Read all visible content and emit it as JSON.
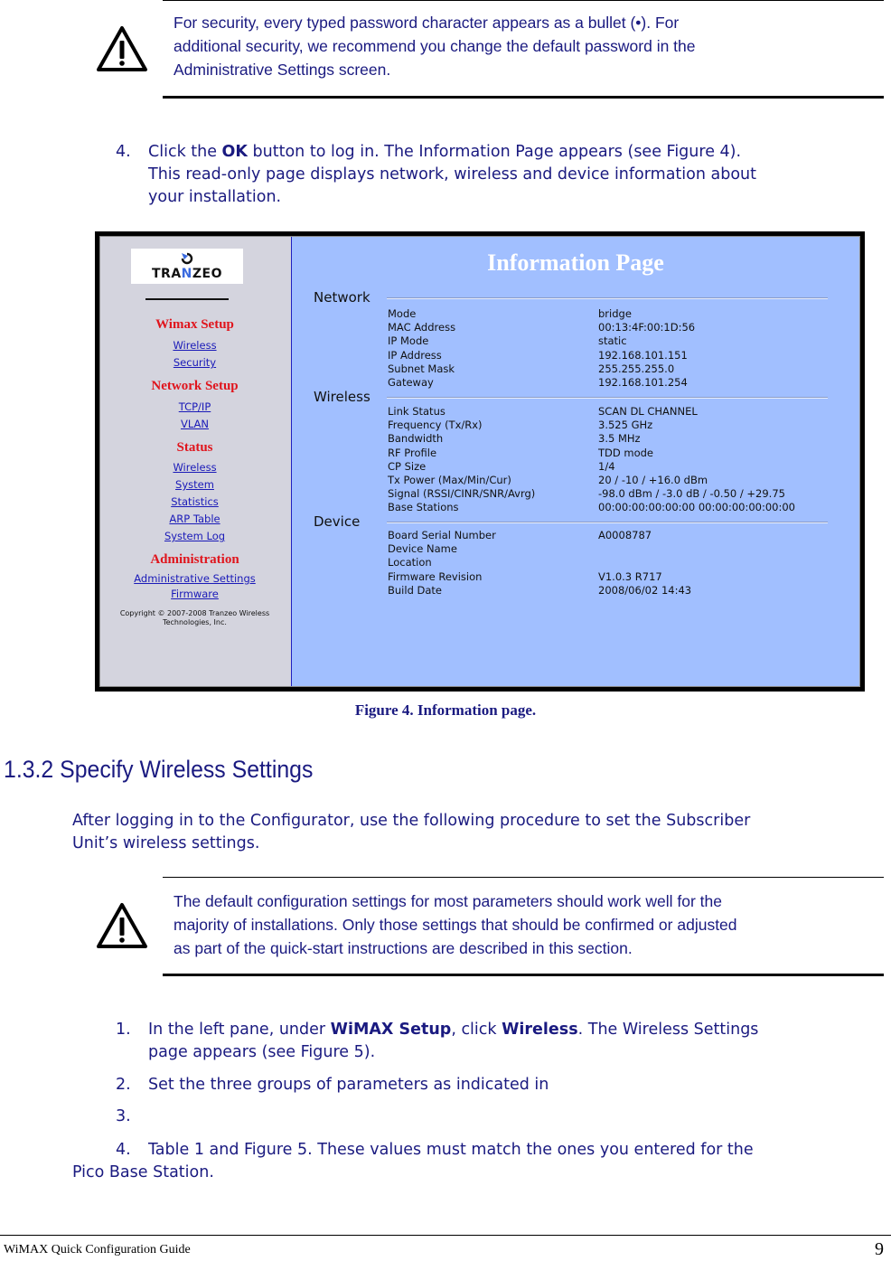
{
  "note1": {
    "icon": "warning-icon",
    "lines": [
      "For security, every typed password character appears as a bullet (•). For",
      "additional security, we recommend you change the default password in the",
      "Administrative Settings screen."
    ]
  },
  "step4": {
    "number": "4.",
    "pre": "Click the ",
    "bold": "OK",
    "post": " button to log in. The Information Page appears (see Figure 4).",
    "line2": "This read-only page displays network, wireless and device information about",
    "line3": "your installation."
  },
  "figure": {
    "sidebar": {
      "logo_text_a": "TRA",
      "logo_text_n": "N",
      "logo_text_b": "ZEO",
      "groups": [
        {
          "heading": "Wimax Setup",
          "links": [
            "Wireless",
            "Security"
          ]
        },
        {
          "heading": "Network Setup",
          "links": [
            "TCP/IP",
            "VLAN"
          ]
        },
        {
          "heading": "Status",
          "links": [
            "Wireless",
            "System",
            "Statistics",
            "ARP Table",
            "System Log"
          ]
        },
        {
          "heading": "Administration",
          "links": [
            "Administrative Settings",
            "Firmware"
          ]
        }
      ],
      "copyright_line1": "Copyright © 2007-2008 Tranzeo Wireless",
      "copyright_line2": "Technologies, Inc."
    },
    "main": {
      "title": "Information Page",
      "sections": [
        {
          "label": "Network",
          "rows": [
            {
              "label": "Mode",
              "value": "bridge"
            },
            {
              "label": "MAC Address",
              "value": "00:13:4F:00:1D:56"
            },
            {
              "label": "IP Mode",
              "value": "static"
            },
            {
              "label": "IP Address",
              "value": "192.168.101.151"
            },
            {
              "label": "Subnet Mask",
              "value": "255.255.255.0"
            },
            {
              "label": "Gateway",
              "value": "192.168.101.254"
            }
          ]
        },
        {
          "label": "Wireless",
          "rows": [
            {
              "label": "Link Status",
              "value": "SCAN DL CHANNEL"
            },
            {
              "label": "Frequency (Tx/Rx)",
              "value": "3.525 GHz"
            },
            {
              "label": "Bandwidth",
              "value": "3.5 MHz"
            },
            {
              "label": "RF Profile",
              "value": "TDD mode"
            },
            {
              "label": "CP Size",
              "value": "1/4"
            },
            {
              "label": "Tx Power (Max/Min/Cur)",
              "value": "20 / -10 / +16.0 dBm"
            },
            {
              "label": "Signal (RSSI/CINR/SNR/Avrg)",
              "value": "-98.0 dBm / -3.0 dB / -0.50 / +29.75"
            },
            {
              "label": "Base Stations",
              "value": "00:00:00:00:00:00 00:00:00:00:00:00"
            }
          ]
        },
        {
          "label": "Device",
          "rows": [
            {
              "label": "Board Serial Number",
              "value": "A0008787"
            },
            {
              "label": "Device Name",
              "value": ""
            },
            {
              "label": "Location",
              "value": ""
            },
            {
              "label": "Firmware Revision",
              "value": "V1.0.3 R717"
            },
            {
              "label": "Build Date",
              "value": "2008/06/02 14:43"
            }
          ]
        }
      ]
    },
    "caption": "Figure 4. Information page."
  },
  "section": {
    "heading": "1.3.2 Specify Wireless Settings",
    "intro_line1": "After logging in to the Configurator, use the following procedure to set the Subscriber",
    "intro_line2": "Unit’s wireless settings."
  },
  "note2": {
    "icon": "warning-icon",
    "lines": [
      "The default configuration settings for most parameters should work well for the",
      "majority of installations. Only those settings that should be confirmed or adjusted",
      "as part of the quick-start instructions are described in this section."
    ]
  },
  "steps": {
    "s1": {
      "number": "1.",
      "pre": "In the left pane, under ",
      "bold1": "WiMAX Setup",
      "mid": ", click ",
      "bold2": "Wireless",
      "post": ". The Wireless Settings",
      "line2": "page appears (see Figure 5)."
    },
    "s2": {
      "number": "2.",
      "text": "Set the three groups of parameters as indicated in"
    },
    "s3": {
      "number": "3.",
      "text": ""
    },
    "s4": {
      "number": "4.",
      "text": "Table 1 and Figure 5. These values must match the ones you entered for the",
      "line2": "Pico Base Station."
    }
  },
  "footer": {
    "title": "WiMAX Quick Configuration Guide",
    "page": "9"
  },
  "colors": {
    "text": "#1a1a80",
    "sidebar_bg": "#d4d4de",
    "main_bg": "#a1bfff",
    "sidebar_heading": "#e0141c",
    "sidebar_link": "#1a1ab8"
  }
}
